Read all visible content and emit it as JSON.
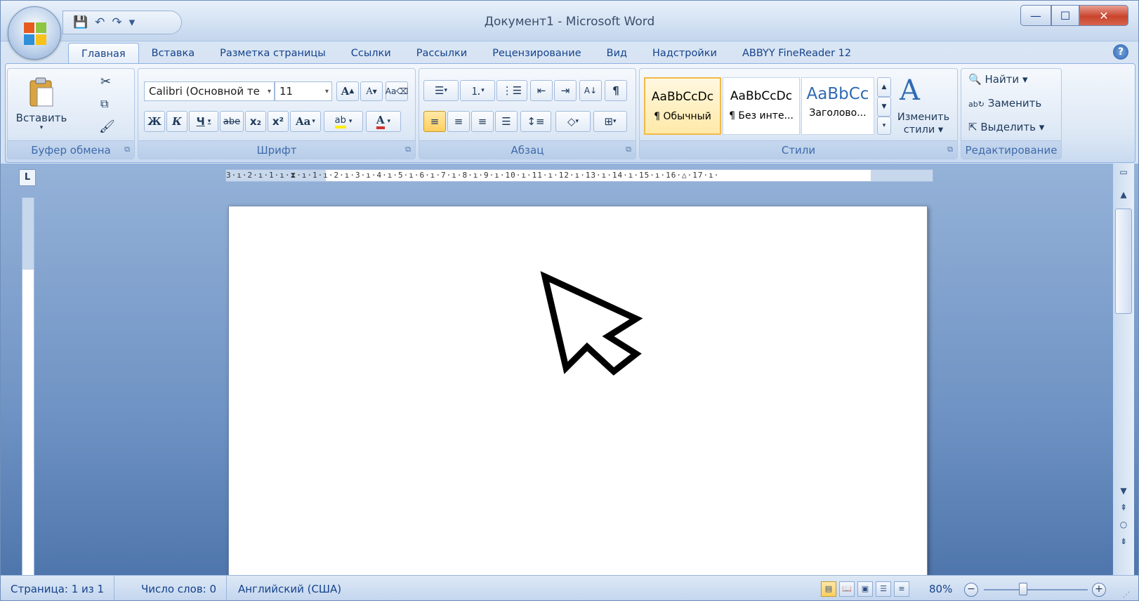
{
  "window": {
    "title": "Документ1 - Microsoft Word",
    "controls": {
      "minimize": "—",
      "maximize": "☐",
      "close": "✕"
    }
  },
  "qat": {
    "save_icon": "floppy-icon",
    "undo_icon": "undo-icon",
    "redo_icon": "redo-icon",
    "customize_icon": "dropdown-icon"
  },
  "tabs": [
    {
      "label": "Главная",
      "active": true
    },
    {
      "label": "Вставка"
    },
    {
      "label": "Разметка страницы"
    },
    {
      "label": "Ссылки"
    },
    {
      "label": "Рассылки"
    },
    {
      "label": "Рецензирование"
    },
    {
      "label": "Вид"
    },
    {
      "label": "Надстройки"
    },
    {
      "label": "ABBYY FineReader 12"
    }
  ],
  "ribbon": {
    "clipboard": {
      "label": "Буфер обмена",
      "paste_label": "Вставить"
    },
    "font": {
      "label": "Шрифт",
      "font_name": "Calibri (Основной те",
      "font_size": "11",
      "bold": "Ж",
      "italic": "К",
      "underline": "Ч",
      "strike": "abe",
      "subscript": "x₂",
      "superscript": "x²",
      "case": "Aa",
      "grow": "A",
      "shrink": "A",
      "highlight": "ab",
      "font_color": "A"
    },
    "paragraph": {
      "label": "Абзац",
      "pilcrow": "¶"
    },
    "styles": {
      "label": "Стили",
      "items": [
        {
          "sample": "AaBbCcDc",
          "name": "¶ Обычный",
          "selected": true
        },
        {
          "sample": "AaBbCcDc",
          "name": "¶ Без инте..."
        },
        {
          "sample": "AaBbCc",
          "name": "Заголово..."
        }
      ],
      "change_styles": "Изменить стили"
    },
    "editing": {
      "label": "Редактирование",
      "find": "Найти",
      "replace": "Заменить",
      "select": "Выделить"
    }
  },
  "ruler": {
    "corner": "L",
    "ticks": "3·ı·2·ı·1·ı·⧗·ı·1·ı·2·ı·3·ı·4·ı·5·ı·6·ı·7·ı·8·ı·9·ı·10·ı·11·ı·12·ı·13·ı·14·ı·15·ı·16·△·17·ı·"
  },
  "status": {
    "page": "Страница: 1 из 1",
    "words": "Число слов: 0",
    "language": "Английский (США)",
    "zoom": "80%",
    "zoom_level": 0.4
  },
  "colors": {
    "accent": "#15428b",
    "close": "#c9442c",
    "selected_style": "#f2b947"
  }
}
